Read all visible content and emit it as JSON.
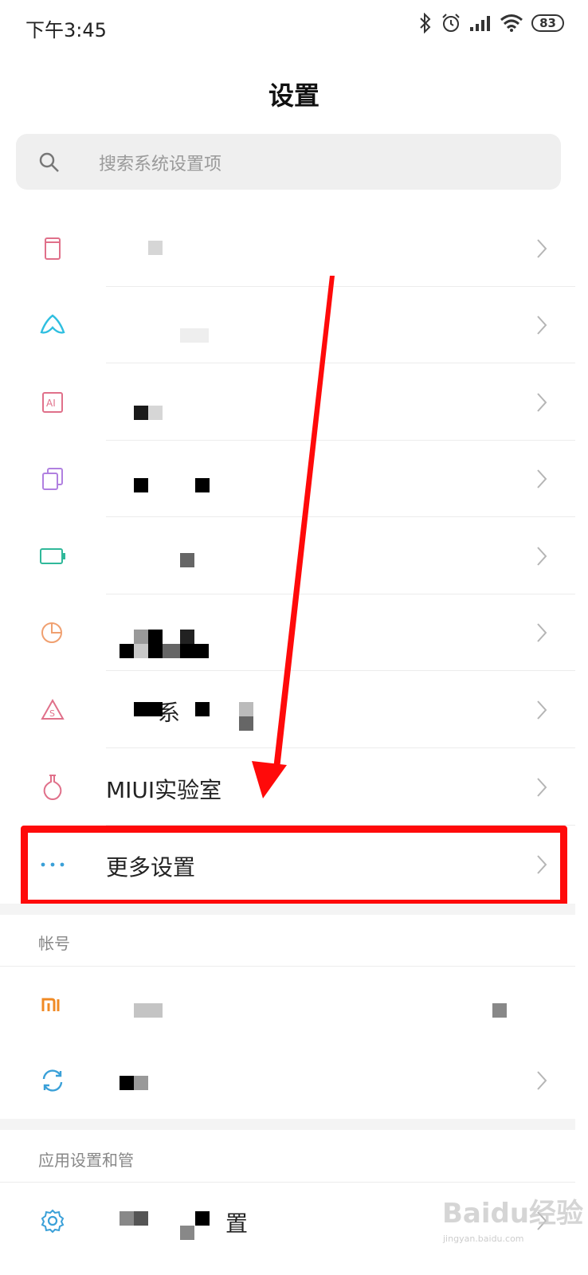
{
  "status": {
    "time": "下午3:45",
    "battery": "83"
  },
  "header": {
    "title": "设置"
  },
  "search": {
    "placeholder": "搜索系统设置项"
  },
  "rows": [
    {
      "icon": "phone-outline-icon",
      "label": ""
    },
    {
      "icon": "mountain-icon",
      "label": ""
    },
    {
      "icon": "ai-icon",
      "label": ""
    },
    {
      "icon": "copy-icon",
      "label": ""
    },
    {
      "icon": "battery-icon",
      "label": ""
    },
    {
      "icon": "pie-chart-icon",
      "label": ""
    },
    {
      "icon": "security-icon",
      "label": "系"
    },
    {
      "icon": "flask-icon",
      "label": "MIUI实验室"
    },
    {
      "icon": "more-dots-icon",
      "label": "更多设置"
    }
  ],
  "account": {
    "section_label": "帐号",
    "rows": [
      {
        "icon": "mi-logo-icon",
        "label": ""
      },
      {
        "icon": "sync-icon",
        "label": ""
      }
    ]
  },
  "apps": {
    "section_label": "应用设置和管",
    "rows": [
      {
        "icon": "gear-icon",
        "label": "置"
      }
    ]
  },
  "watermark": {
    "text": "Baidu经验",
    "sub": "jingyan.baidu.com"
  },
  "colors": {
    "highlight": "#ff0a0a",
    "arrow": "#ff0a0a",
    "accent_blue": "#3aa0d8"
  }
}
